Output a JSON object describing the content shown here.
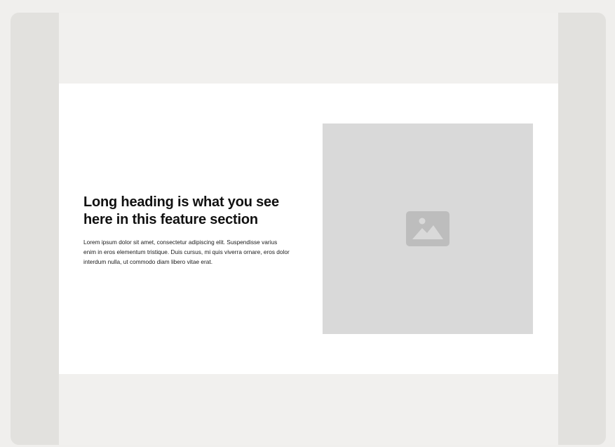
{
  "feature": {
    "heading": "Long heading is what you see here in this feature section",
    "body": "Lorem ipsum dolor sit amet, consectetur adipiscing elit. Suspendisse varius enim in eros elementum tristique. Duis cursus, mi quis viverra ornare, eros dolor interdum nulla, ut commodo diam libero vitae erat."
  },
  "image": {
    "icon": "image-icon"
  },
  "colors": {
    "page_background": "#f0efed",
    "frame_background": "#e2e1de",
    "section_background": "#ffffff",
    "placeholder_background": "#d9d9d9",
    "icon_color": "#bdbdbd"
  }
}
